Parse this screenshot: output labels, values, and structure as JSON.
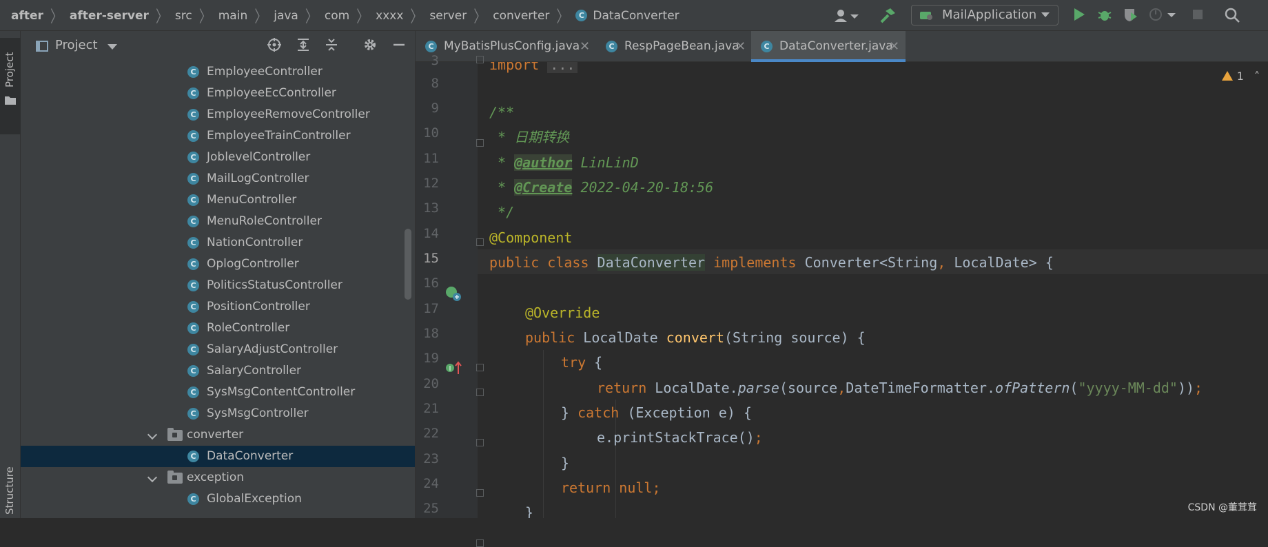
{
  "navbar": {
    "breadcrumbs": [
      "after",
      "after-server",
      "src",
      "main",
      "java",
      "com",
      "xxxx",
      "server",
      "converter",
      "DataConverter"
    ],
    "run_config": "MailApplication"
  },
  "side_strip": {
    "project_label": "Project",
    "structure_label": "Structure"
  },
  "project_panel": {
    "title": "Project",
    "tree": [
      {
        "type": "class",
        "label": "EmployeeController"
      },
      {
        "type": "class",
        "label": "EmployeeEcController"
      },
      {
        "type": "class",
        "label": "EmployeeRemoveController"
      },
      {
        "type": "class",
        "label": "EmployeeTrainController"
      },
      {
        "type": "class",
        "label": "JoblevelController"
      },
      {
        "type": "class",
        "label": "MailLogController"
      },
      {
        "type": "class",
        "label": "MenuController"
      },
      {
        "type": "class",
        "label": "MenuRoleController"
      },
      {
        "type": "class",
        "label": "NationController"
      },
      {
        "type": "class",
        "label": "OplogController"
      },
      {
        "type": "class",
        "label": "PoliticsStatusController"
      },
      {
        "type": "class",
        "label": "PositionController"
      },
      {
        "type": "class",
        "label": "RoleController"
      },
      {
        "type": "class",
        "label": "SalaryAdjustController"
      },
      {
        "type": "class",
        "label": "SalaryController"
      },
      {
        "type": "class",
        "label": "SysMsgContentController"
      },
      {
        "type": "class",
        "label": "SysMsgController"
      },
      {
        "type": "folder",
        "label": "converter"
      },
      {
        "type": "class",
        "label": "DataConverter",
        "selected": true
      },
      {
        "type": "folder",
        "label": "exception"
      },
      {
        "type": "class",
        "label": "GlobalException"
      }
    ]
  },
  "editor": {
    "tabs": [
      {
        "label": "MyBatisPlusConfig.java",
        "active": false
      },
      {
        "label": "RespPageBean.java",
        "active": false
      },
      {
        "label": "DataConverter.java",
        "active": true
      }
    ],
    "warning_count": "1",
    "line_numbers": [
      "3",
      "8",
      "9",
      "10",
      "11",
      "12",
      "13",
      "14",
      "15",
      "16",
      "17",
      "18",
      "19",
      "20",
      "21",
      "22",
      "23",
      "24",
      "25"
    ],
    "current_line": "15",
    "code": {
      "l3_kw": "import",
      "l3_fold": "...",
      "l9": "/**",
      "l10": " * 日期转换",
      "l11_pre": " * ",
      "l11_tag": "@author",
      "l11_val": " LinLinD",
      "l12_pre": " * ",
      "l12_tag": "@Create",
      "l12_val": " 2022-04-20-18:56",
      "l13": " */",
      "l14": "@Component",
      "l15_kw1": "public class ",
      "l15_name": "DataConverter",
      "l15_kw2": " implements ",
      "l15_rest": "Converter<String",
      "l15_comma": ",",
      "l15_rest2": " LocalDate> {",
      "l17": "@Override",
      "l18_kw": "public ",
      "l18_type": "LocalDate ",
      "l18_fn": "convert",
      "l18_rest": "(String source) {",
      "l19_kw": "try",
      "l19_rest": " {",
      "l20_kw": "return ",
      "l20_a": "LocalDate.",
      "l20_b": "parse",
      "l20_c": "(source",
      "l20_comma": ",",
      "l20_d": "DateTimeFormatter.",
      "l20_e": "ofPattern",
      "l20_f": "(",
      "l20_str": "\"yyyy-MM-dd\"",
      "l20_g": "))",
      "l20_semi": ";",
      "l21_a": "} ",
      "l21_kw": "catch",
      "l21_b": " (Exception e) {",
      "l22_a": "e.printStackTrace()",
      "l22_semi": ";",
      "l23": "}",
      "l24_kw": "return null",
      "l24_semi": ";",
      "l25": "}"
    }
  },
  "watermark": "CSDN @董茸茸",
  "colors": {
    "accent_tab": "#4a88c7",
    "selection": "#0d293e",
    "keyword": "#cc7832",
    "annotation": "#bbb529",
    "doc_comment": "#629755",
    "method": "#ffc66d"
  }
}
